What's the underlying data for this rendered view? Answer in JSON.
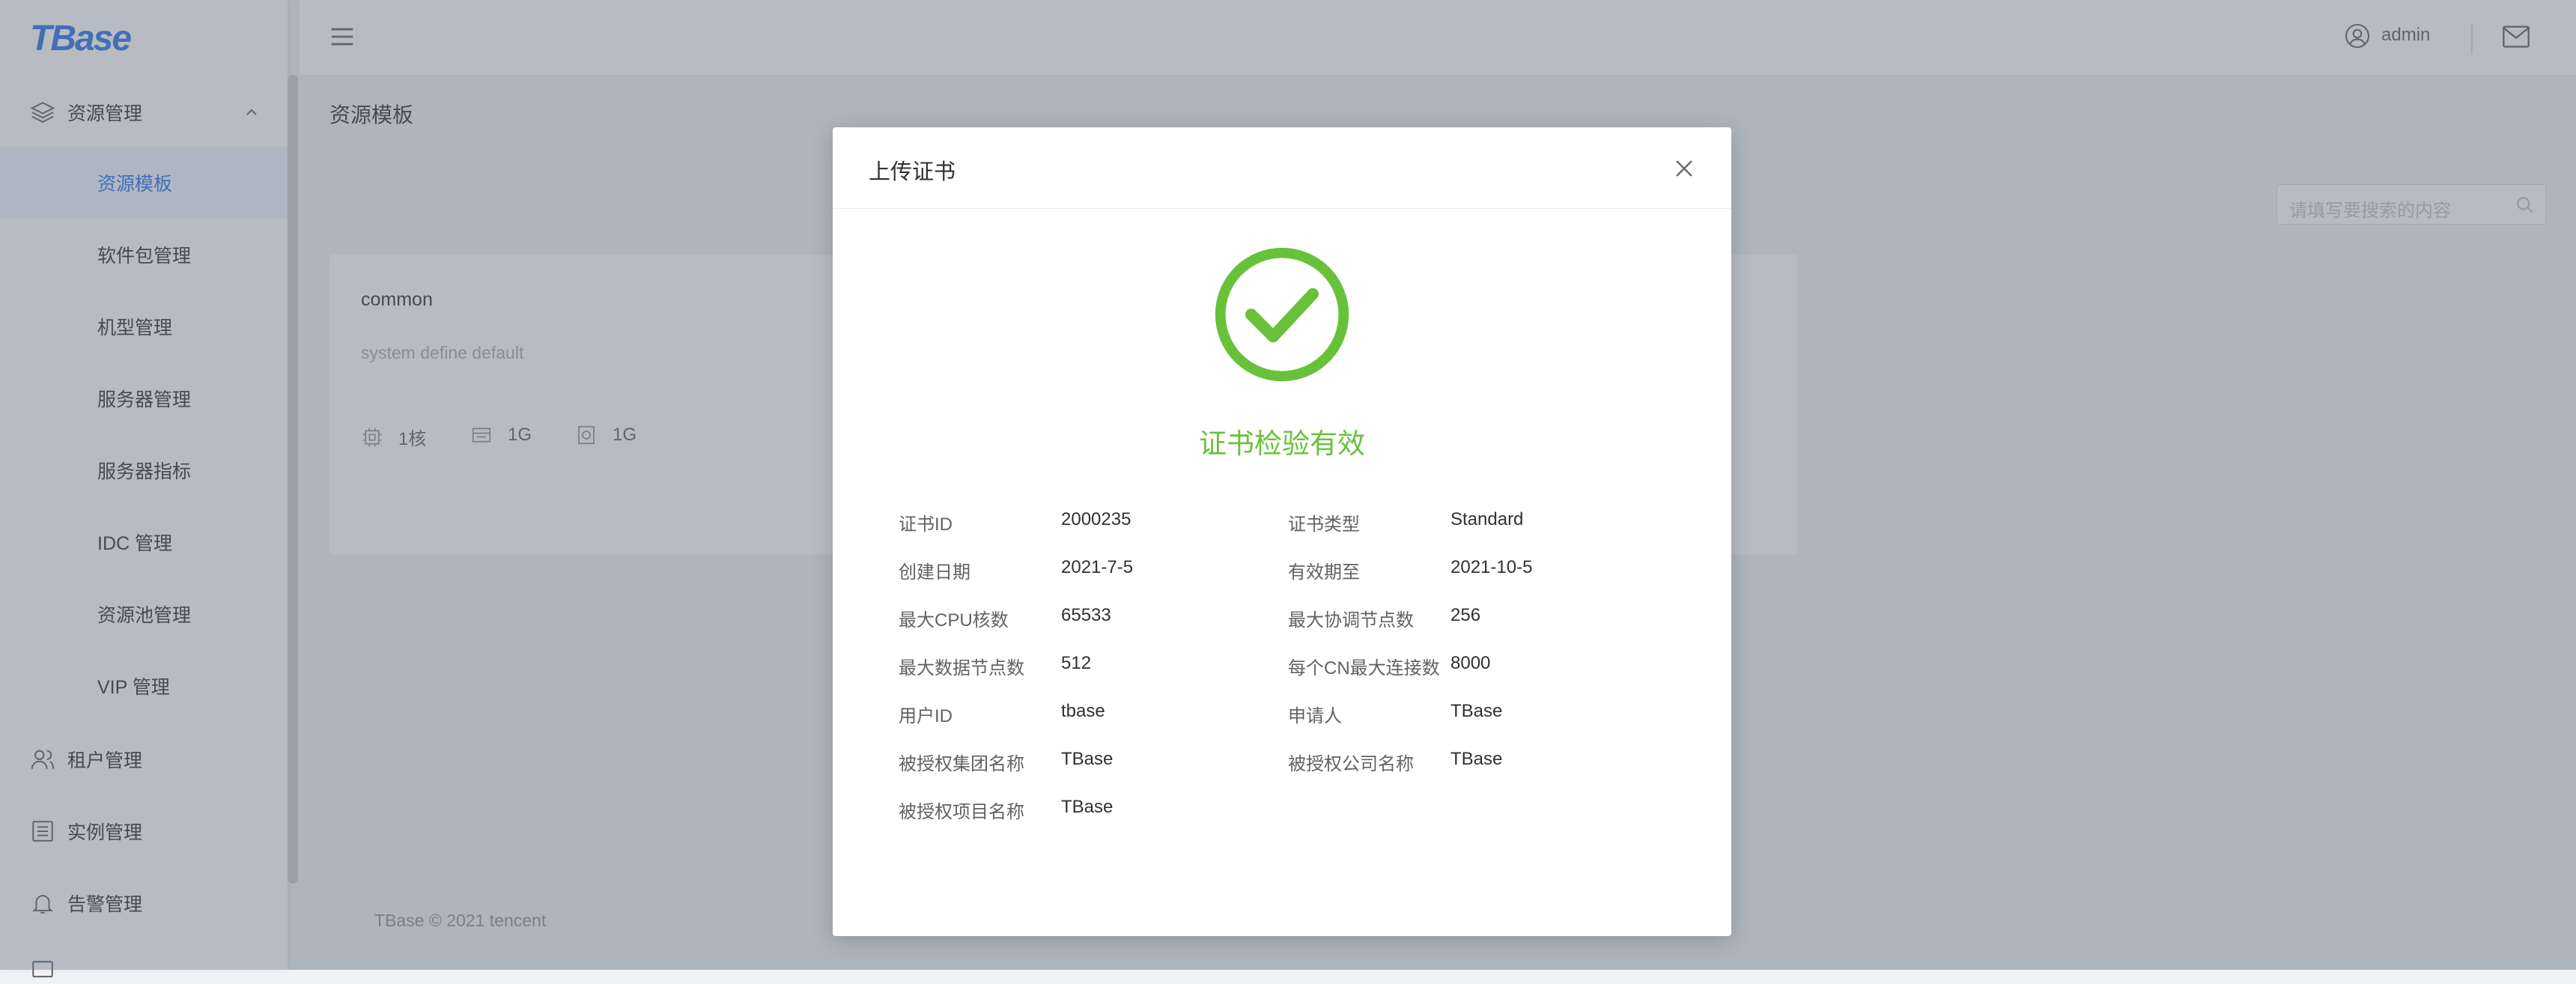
{
  "app": {
    "logo": "TBase"
  },
  "sidebar": {
    "groups": [
      {
        "label": "资源管理",
        "icon": "layers-icon",
        "expanded": true
      },
      {
        "label": "租户管理",
        "icon": "user-icon"
      },
      {
        "label": "实例管理",
        "icon": "list-icon"
      },
      {
        "label": "告警管理",
        "icon": "bell-icon"
      }
    ],
    "resource_items": [
      {
        "label": "资源模板",
        "active": true
      },
      {
        "label": "软件包管理"
      },
      {
        "label": "机型管理"
      },
      {
        "label": "服务器管理"
      },
      {
        "label": "服务器指标"
      },
      {
        "label": "IDC 管理"
      },
      {
        "label": "资源池管理"
      },
      {
        "label": "VIP 管理"
      }
    ]
  },
  "header": {
    "user": "admin",
    "icons": [
      "menu-icon",
      "user-circle-icon",
      "mail-icon"
    ]
  },
  "main": {
    "title": "资源模板",
    "search_placeholder": "请填写要搜索的内容",
    "card": {
      "name": "common",
      "description": "system define default",
      "specs": [
        {
          "icon": "cpu-icon",
          "value": "1核"
        },
        {
          "icon": "memory-icon",
          "value": "1G"
        },
        {
          "icon": "disk-icon",
          "value": "1G"
        }
      ]
    },
    "footer": "TBase © 2021 tencent"
  },
  "modal": {
    "title": "上传证书",
    "status": "证书检验有效",
    "status_color": "#67c23a",
    "fields": [
      {
        "key": "证书ID",
        "value": "2000235"
      },
      {
        "key": "证书类型",
        "value": "Standard"
      },
      {
        "key": "创建日期",
        "value": "2021-7-5"
      },
      {
        "key": "有效期至",
        "value": "2021-10-5"
      },
      {
        "key": "最大CPU核数",
        "value": "65533"
      },
      {
        "key": "最大协调节点数",
        "value": "256"
      },
      {
        "key": "最大数据节点数",
        "value": "512"
      },
      {
        "key": "每个CN最大连接数",
        "value": "8000"
      },
      {
        "key": "用户ID",
        "value": "tbase"
      },
      {
        "key": "申请人",
        "value": "TBase"
      },
      {
        "key": "被授权集团名称",
        "value": "TBase"
      },
      {
        "key": "被授权公司名称",
        "value": "TBase"
      },
      {
        "key": "被授权项目名称",
        "value": "TBase"
      }
    ]
  },
  "colors": {
    "primary": "#2d74e6",
    "success": "#67c23a"
  }
}
